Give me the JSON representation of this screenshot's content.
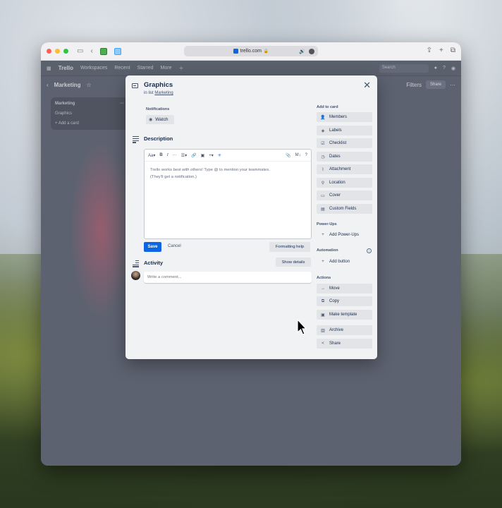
{
  "browser": {
    "url": "trello.com",
    "lock_icon": "lock-icon"
  },
  "trello": {
    "brand": "Trello",
    "nav": [
      "Workspaces",
      "Recent",
      "Starred",
      "More"
    ],
    "search_placeholder": "Search",
    "board_title": "Marketing",
    "filters": "Filters",
    "share": "Share",
    "list_title": "Marketing",
    "cards": [
      "Graphics"
    ],
    "add_card": "+ Add a card"
  },
  "modal": {
    "title": "Graphics",
    "in_list_prefix": "in list",
    "list_name": "Marketing",
    "notifications_label": "Notifications",
    "watch_label": "Watch",
    "description_title": "Description",
    "toolbar": {
      "text_style": "Aa",
      "bold": "B",
      "italic": "I",
      "more": "···",
      "list": "☰",
      "link": "🔗",
      "image": "▣",
      "insert": "+",
      "sparkle": "✳",
      "attach": "📎",
      "heading": "M↓",
      "help": "?"
    },
    "editor_placeholder_line1": "Trello works best with others! Type @ to mention your teammates.",
    "editor_placeholder_line2": "(They'll get a notification.)",
    "save_label": "Save",
    "cancel_label": "Cancel",
    "formatting_help_label": "Formatting help",
    "activity_title": "Activity",
    "show_details_label": "Show details",
    "comment_placeholder": "Write a comment..."
  },
  "sidebar": {
    "add_to_card_label": "Add to card",
    "add_to_card": [
      {
        "label": "Members",
        "icon": "person-icon"
      },
      {
        "label": "Labels",
        "icon": "tag-icon"
      },
      {
        "label": "Checklist",
        "icon": "checklist-icon"
      },
      {
        "label": "Dates",
        "icon": "clock-icon"
      },
      {
        "label": "Attachment",
        "icon": "paperclip-icon"
      },
      {
        "label": "Location",
        "icon": "location-pin-icon"
      },
      {
        "label": "Cover",
        "icon": "cover-icon"
      },
      {
        "label": "Custom Fields",
        "icon": "custom-fields-icon"
      }
    ],
    "powerups_label": "Power-Ups",
    "add_powerups": "Add Power-Ups",
    "automation_label": "Automation",
    "add_button": "Add button",
    "actions_label": "Actions",
    "actions": [
      {
        "label": "Move",
        "icon": "arrow-right-icon"
      },
      {
        "label": "Copy",
        "icon": "copy-icon"
      },
      {
        "label": "Make template",
        "icon": "template-icon"
      },
      {
        "label": "Archive",
        "icon": "archive-icon"
      },
      {
        "label": "Share",
        "icon": "share-icon"
      }
    ]
  },
  "colors": {
    "primary": "#0c66e4",
    "modal_bg": "#f1f2f4",
    "button_bg": "#e2e4e8",
    "text": "#172b4d"
  }
}
